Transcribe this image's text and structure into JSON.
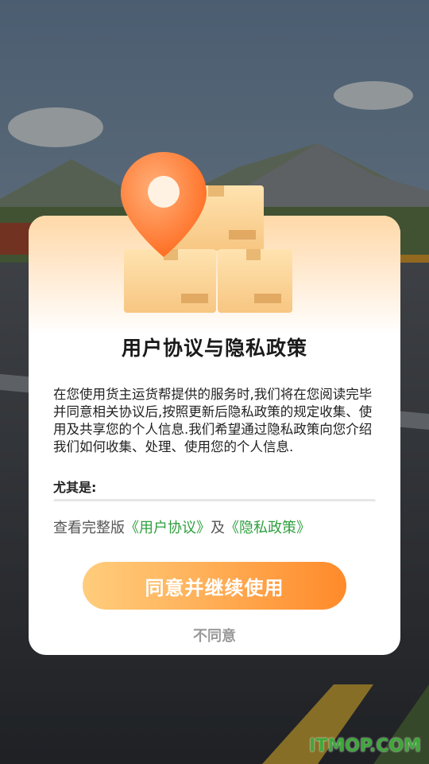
{
  "dialog": {
    "title": "用户协议与隐私政策",
    "body": "在您使用货主运货帮提供的服务时,我们将在您阅读完毕并同意相关协议后,按照更新后隐私政策的规定收集、使用及共享您的个人信息.我们希望通过隐私政策向您介绍我们如何收集、处理、使用您的个人信息.",
    "sub_label": "尤其是:",
    "links_prefix": "查看完整版",
    "link_user_agreement": "《用户协议》",
    "links_and": "及",
    "link_privacy_policy": "《隐私政策》",
    "agree_button": "同意并继续使用",
    "disagree_button": "不同意"
  },
  "watermark": "ITMOP.COM",
  "colors": {
    "accent_orange": "#ff8a2a",
    "link_green": "#2e9f3e",
    "pin_orange": "#ff7a2a"
  },
  "icons": [
    "map-pin-icon",
    "package-box-icon"
  ]
}
